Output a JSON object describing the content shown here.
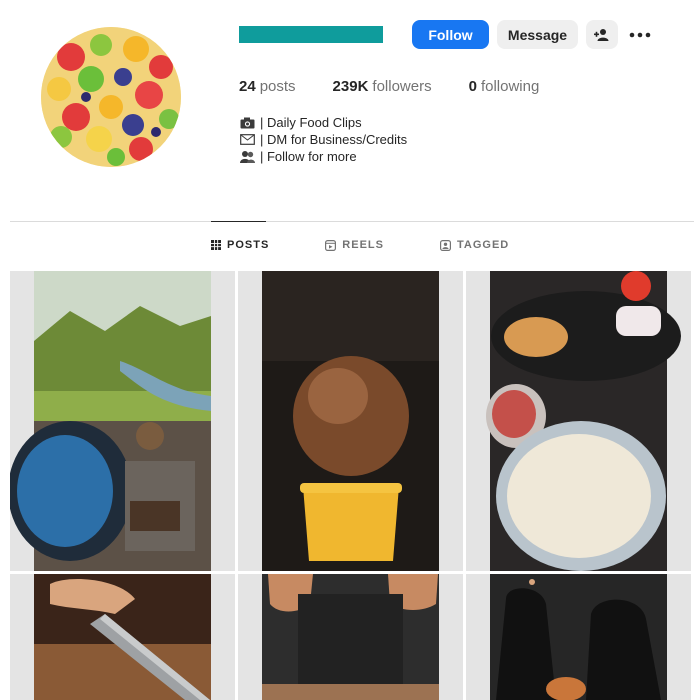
{
  "profile": {
    "avatar_icon": "fruit-salad-avatar"
  },
  "header": {
    "follow_label": "Follow",
    "message_label": "Message",
    "suggest_icon": "add-person-icon",
    "more_icon": "more-icon",
    "username_bar_color": "#0f9c9c",
    "follow_color": "#1877f2"
  },
  "stats": [
    {
      "value": "24",
      "label": "posts"
    },
    {
      "value": "239K",
      "label": "followers"
    },
    {
      "value": "0",
      "label": "following"
    }
  ],
  "bio": [
    {
      "icon": "camera-icon",
      "text": "| Daily Food Clips"
    },
    {
      "icon": "envelope-icon",
      "text": "| DM for Business/Credits"
    },
    {
      "icon": "people-icon",
      "text": "| Follow for more"
    }
  ],
  "tabs": [
    {
      "label": "POSTS",
      "icon": "grid-icon",
      "active": true
    },
    {
      "label": "REELS",
      "icon": "reels-icon",
      "active": false
    },
    {
      "label": "TAGGED",
      "icon": "tagged-icon",
      "active": false
    }
  ],
  "posts": [
    {
      "subject": "Cooking pan on campfire by stream"
    },
    {
      "subject": "Coconut in yellow ramekin"
    },
    {
      "subject": "Flatbread on griddle with dough bowl"
    },
    {
      "subject": "Knife slicing on wooden board"
    },
    {
      "subject": "Chef at work table"
    },
    {
      "subject": "Gloved hands preparing food"
    }
  ]
}
